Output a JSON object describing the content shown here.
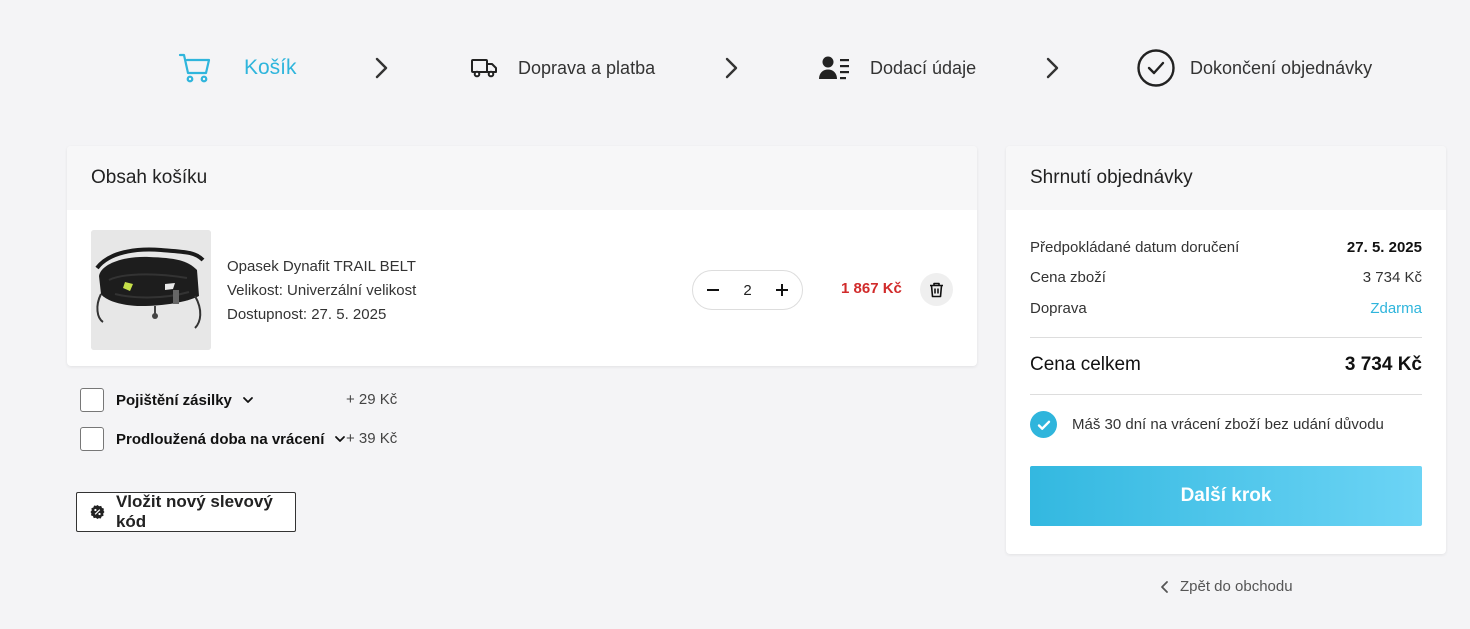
{
  "steps": [
    {
      "label": "Košík",
      "icon": "cart-icon",
      "active": true
    },
    {
      "label": "Doprava a platba",
      "icon": "truck-icon",
      "active": false
    },
    {
      "label": "Dodací údaje",
      "icon": "user-list-icon",
      "active": false
    },
    {
      "label": "Dokončení objednávky",
      "icon": "check-circle-icon",
      "active": false
    }
  ],
  "cart": {
    "title": "Obsah košíku",
    "item": {
      "name": "Opasek Dynafit TRAIL BELT",
      "size": "Velikost: Univerzální velikost",
      "availability": "Dostupnost:  27. 5. 2025",
      "quantity": "2",
      "price": "1 867 Kč"
    }
  },
  "addons": [
    {
      "label": "Pojištění zásilky",
      "price": "+ 29 Kč"
    },
    {
      "label": "Prodloužená doba na vrácení",
      "price": "+ 39 Kč"
    }
  ],
  "discount": {
    "label": "Vložit nový slevový kód"
  },
  "summary": {
    "title": "Shrnutí objednávky",
    "rows": [
      {
        "label": "Předpokládané datum doručení",
        "value": "27. 5. 2025"
      },
      {
        "label": "Cena zboží",
        "value": "3 734 Kč"
      },
      {
        "label": "Doprava",
        "value": "Zdarma"
      }
    ],
    "total_label": "Cena celkem",
    "total_value": "3 734 Kč",
    "returns_text": "Máš 30 dní na vrácení zboží bez udání důvodu",
    "next_label": "Další krok"
  },
  "back_link": "Zpět do obchodu",
  "colors": {
    "accent": "#2fb5dc",
    "price_red": "#d12b2b",
    "background": "#f4f4f6"
  }
}
